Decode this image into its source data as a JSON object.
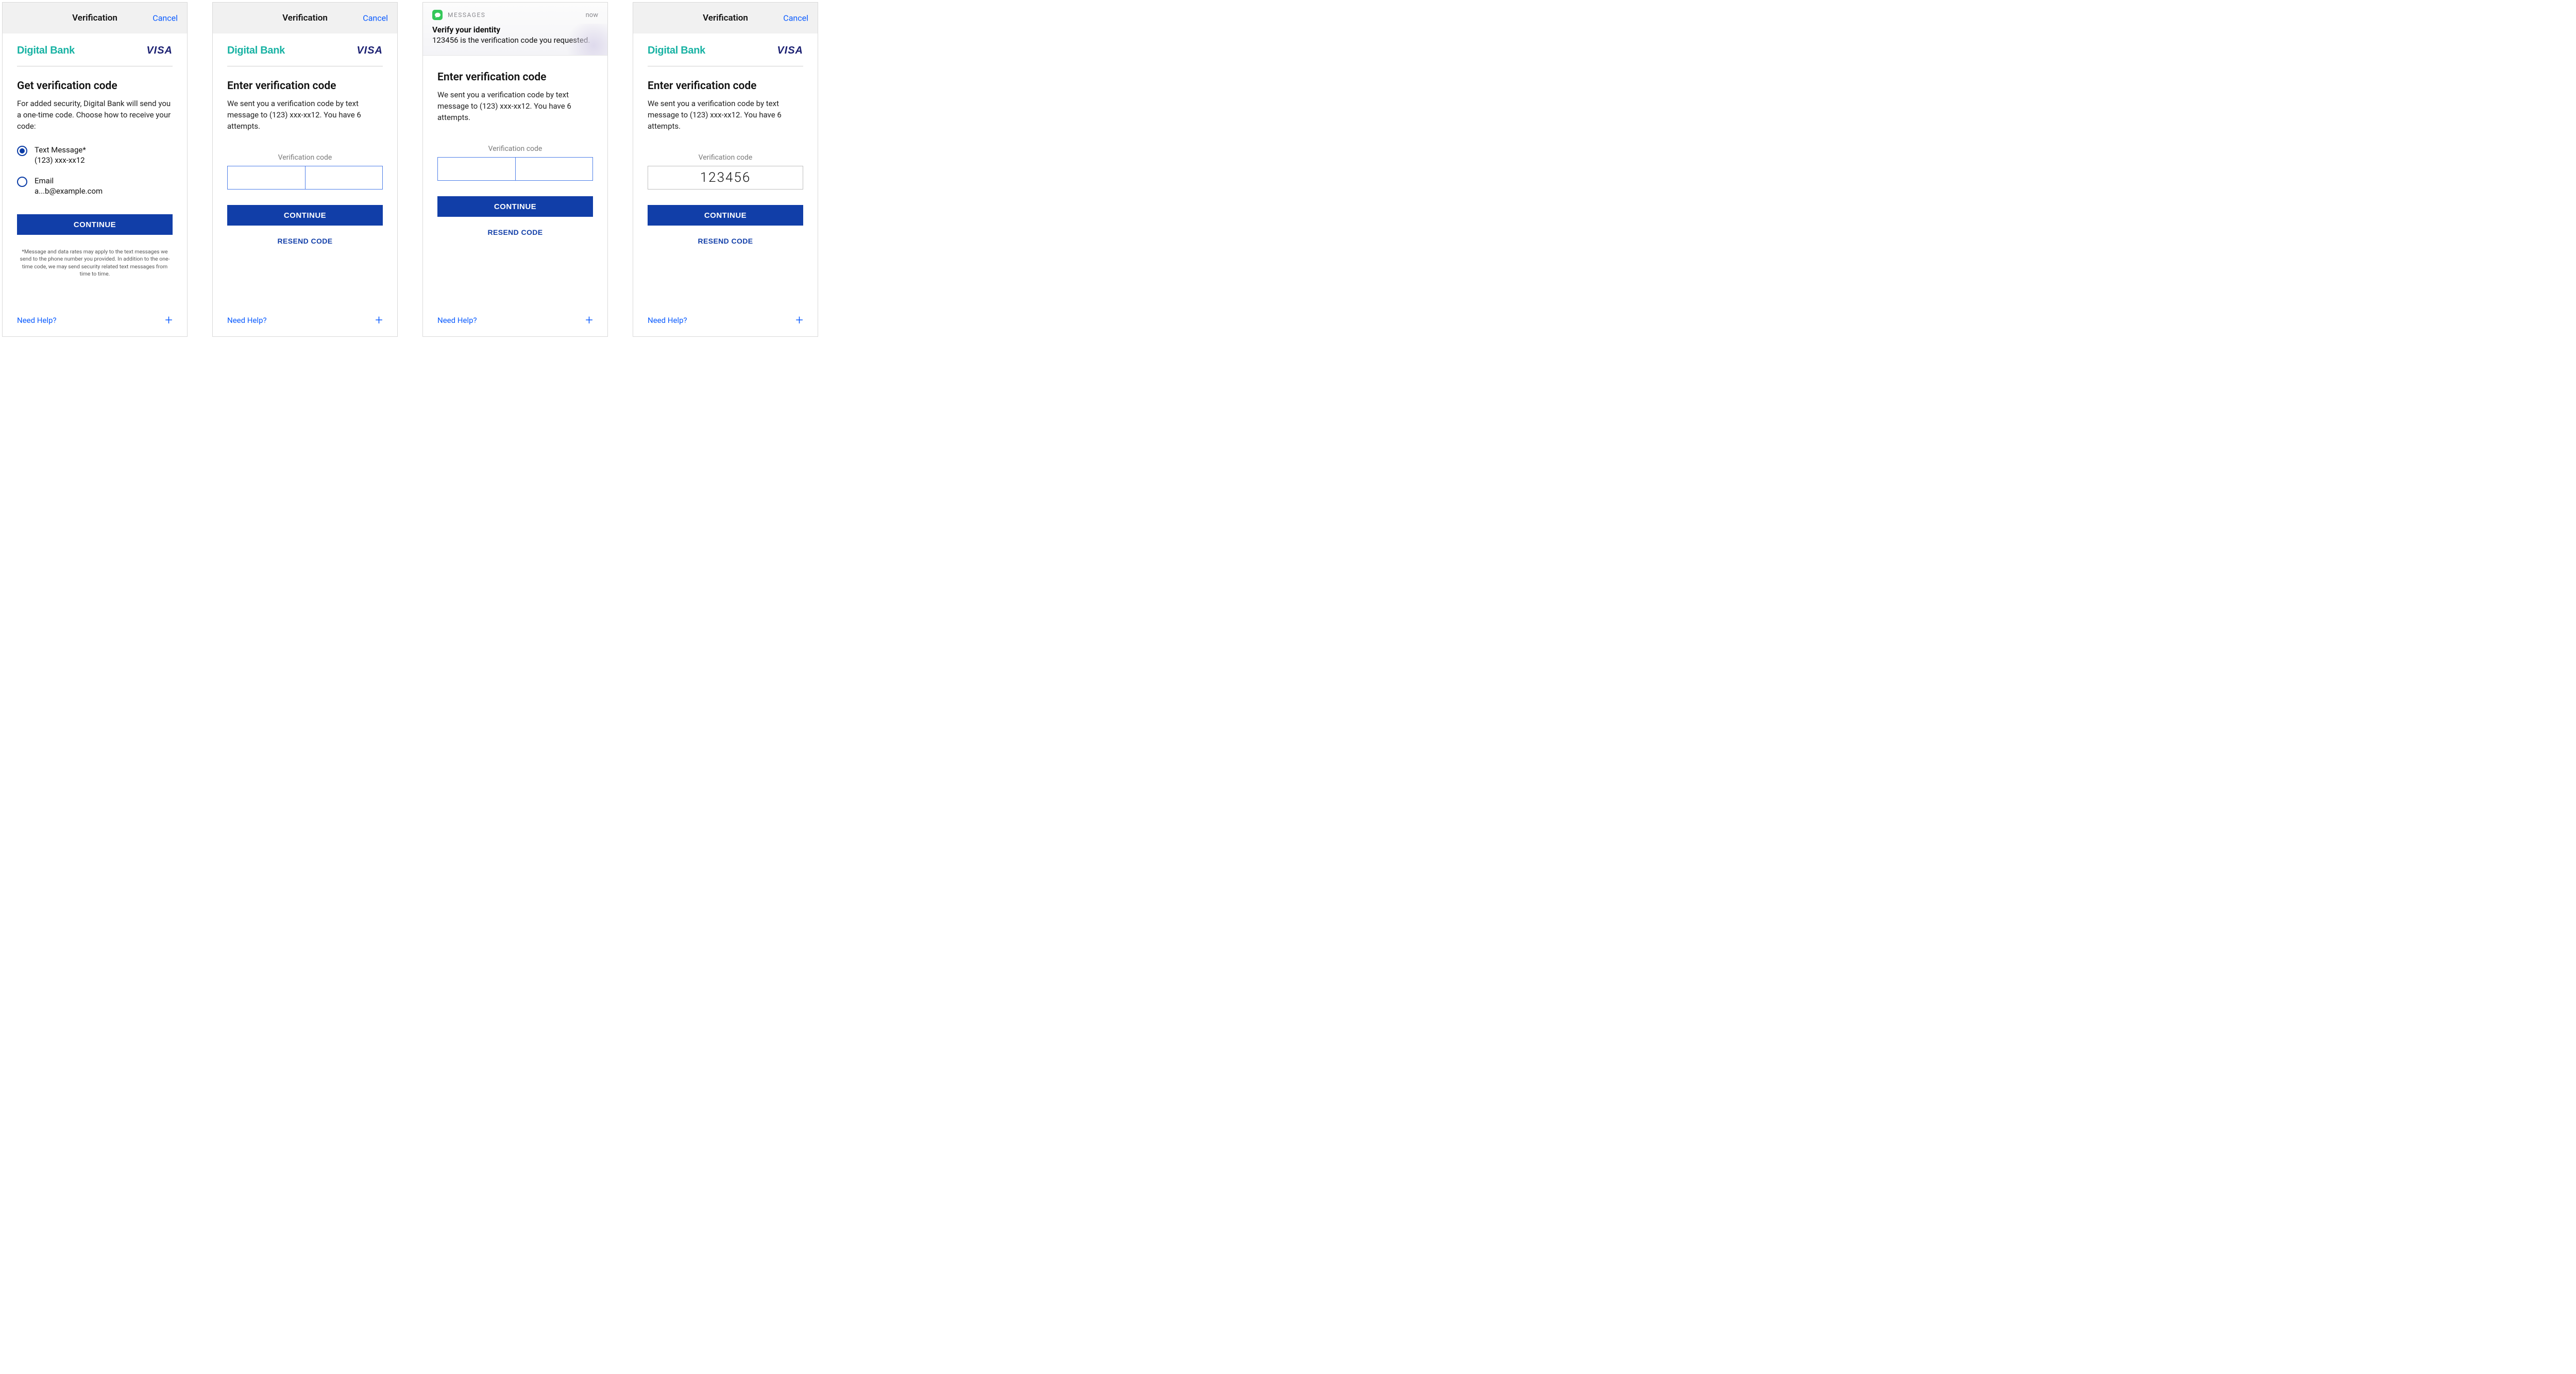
{
  "colors": {
    "primary": "#113ea8",
    "link": "#0a5bff",
    "brandTeal": "#17b2a3",
    "visaNavy": "#1a1f71"
  },
  "common": {
    "topbar_title": "Verification",
    "cancel": "Cancel",
    "bank_name": "Digital Bank",
    "visa": "VISA",
    "help": "Need Help?",
    "continue": "CONTINUE",
    "resend": "RESEND CODE",
    "code_label": "Verification code"
  },
  "screen1": {
    "heading": "Get verification code",
    "body": "For added security, Digital Bank will send you a one-time code. Choose how to receive your code:",
    "options": [
      {
        "label": "Text Message*",
        "sub": "(123) xxx-xx12",
        "checked": true
      },
      {
        "label": "Email",
        "sub": "a...b@example.com",
        "checked": false
      }
    ],
    "footnote": "*Message and data rates may apply to the text messages we send to the phone number you provided. In addition to the one-time code, we may send security related text messages from time to time."
  },
  "screen2": {
    "heading": "Enter verification code",
    "body": "We sent you a verification code by text message to (123) xxx-xx12. You have 6 attempts."
  },
  "screen3": {
    "notif_app": "MESSAGES",
    "notif_time": "now",
    "notif_title": "Verify your identity",
    "notif_body": "123456 is the verification code you requested.",
    "heading": "Enter verification code",
    "body": "We sent you a verification code by text message to (123) xxx-xx12. You have 6 attempts."
  },
  "screen4": {
    "heading": "Enter verification code",
    "body": "We sent you a verification code by text message to (123) xxx-xx12. You have 6 attempts.",
    "code_value": "123456"
  }
}
